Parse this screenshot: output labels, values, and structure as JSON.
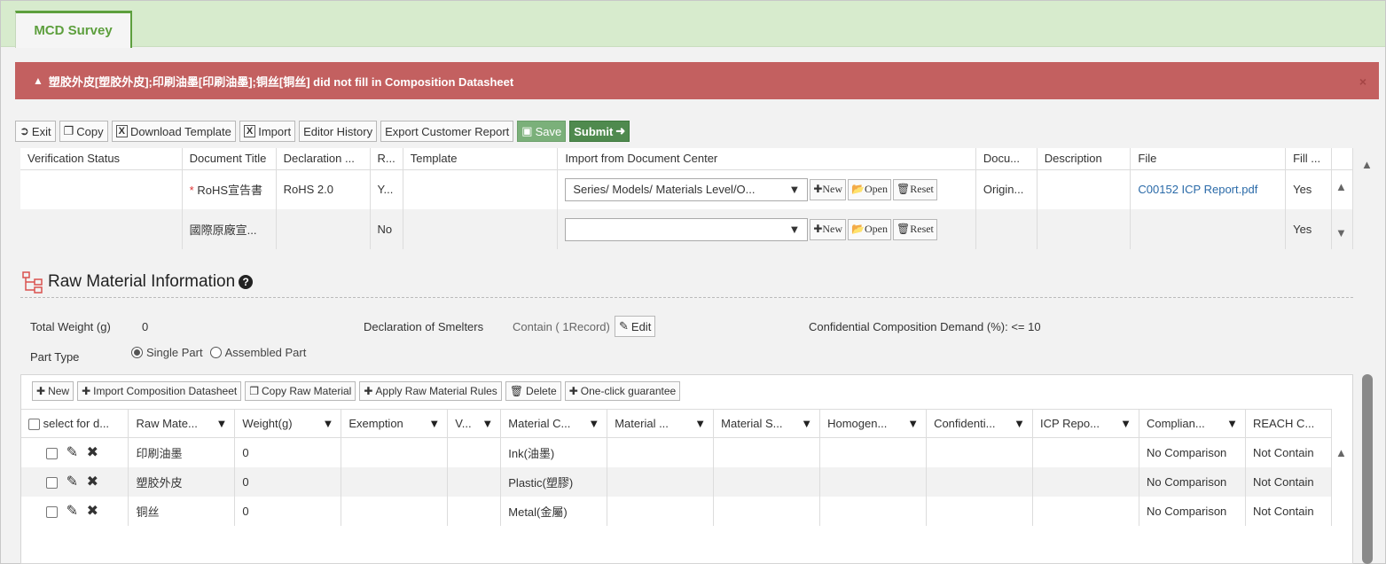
{
  "tab": {
    "label": "MCD Survey"
  },
  "alert": {
    "message": "塑胶外皮[塑胶外皮];印刷油墨[印刷油墨];铜丝[铜丝] did not fill in Composition Datasheet",
    "close": "×"
  },
  "toolbar": {
    "exit": "Exit",
    "copy": "Copy",
    "download_template": "Download Template",
    "import": "Import",
    "editor_history": "Editor History",
    "export_customer_report": "Export Customer Report",
    "save": "Save",
    "submit": "Submit"
  },
  "doc_table": {
    "headers": [
      "Verification Status",
      "Document Title",
      "Declaration ...",
      "R...",
      "Template",
      "Import from Document Center",
      "Docu...",
      "Description",
      "File",
      "Fill ..."
    ],
    "rows": [
      {
        "verification": "",
        "title": "RoHS宣告書",
        "required": "*",
        "declaration": "RoHS 2.0",
        "r": "Y...",
        "template": "",
        "import_select": "Series/ Models/ Materials Level/O...",
        "docu": "Origin...",
        "description": "",
        "file": "C00152 ICP Report.pdf",
        "fill": "Yes"
      },
      {
        "verification": "",
        "title": "國際原廠宣...",
        "required": "",
        "declaration": "",
        "r": "No",
        "template": "",
        "import_select": "",
        "docu": "",
        "description": "",
        "file": "",
        "fill": "Yes"
      }
    ],
    "actions": {
      "new": "New",
      "open": "Open",
      "reset": "Reset"
    }
  },
  "raw_material": {
    "title": "Raw Material Information",
    "total_weight_label": "Total Weight (g)",
    "total_weight_value": "0",
    "smelters_label": "Declaration of Smelters",
    "smelters_value": "Contain ( 1Record)",
    "smelters_edit": "Edit",
    "confidential_label": "Confidential Composition Demand (%): <= 10",
    "part_type_label": "Part Type",
    "single_part": "Single Part",
    "assembled_part": "Assembled Part"
  },
  "mat_toolbar": {
    "new": "New",
    "import_cd": "Import Composition Datasheet",
    "copy_raw": "Copy Raw Material",
    "apply_rules": "Apply Raw Material Rules",
    "delete": "Delete",
    "one_click": "One-click guarantee"
  },
  "mat_table": {
    "headers": [
      "select for d...",
      "Raw Mate...",
      "Weight(g)",
      "Exemption",
      "V...",
      "Material C...",
      "Material ...",
      "Material S...",
      "Homogen...",
      "Confidenti...",
      "ICP Repo...",
      "Complian...",
      "REACH C..."
    ],
    "rows": [
      {
        "raw": "印刷油墨",
        "weight": "0",
        "category": "Ink(油墨)",
        "compliance": "No Comparison",
        "reach": "Not Contain"
      },
      {
        "raw": "塑胶外皮",
        "weight": "0",
        "category": "Plastic(塑膠)",
        "compliance": "No Comparison",
        "reach": "Not Contain"
      },
      {
        "raw": "铜丝",
        "weight": "0",
        "category": "Metal(金屬)",
        "compliance": "No Comparison",
        "reach": "Not Contain"
      }
    ]
  },
  "icons": [
    "exit-icon",
    "copy-icon",
    "excel-icon",
    "save-icon",
    "arrow-right-icon",
    "dropdown-caret-icon",
    "plus-icon",
    "folder-open-icon",
    "trash-icon",
    "filter-icon",
    "pencil-icon",
    "delete-x-icon",
    "help-icon",
    "hierarchy-icon"
  ]
}
